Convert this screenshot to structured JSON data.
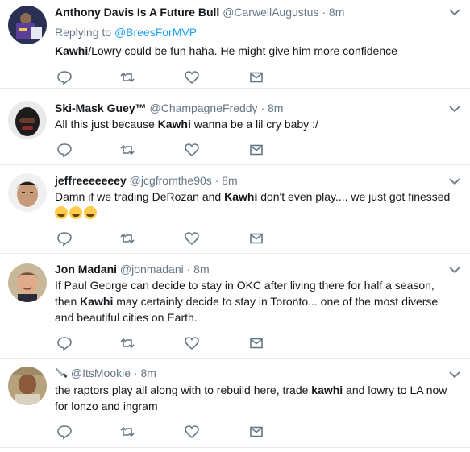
{
  "tweets": [
    {
      "name": "Anthony Davis Is A Future Bull",
      "handle": "@CarwellAugustus",
      "time": "8m",
      "reply_prefix": "Replying to ",
      "reply_handle": "@BreesForMVP",
      "text_parts": [
        {
          "t": "Kawhi",
          "b": true
        },
        {
          "t": "/Lowry could be fun haha. He might give him more confidence",
          "b": false
        }
      ]
    },
    {
      "name": "Ski-Mask Guey™",
      "handle": "@ChampagneFreddy",
      "time": "8m",
      "text_parts": [
        {
          "t": "All this just because ",
          "b": false
        },
        {
          "t": "Kawhi",
          "b": true
        },
        {
          "t": " wanna be a lil cry baby :/",
          "b": false
        }
      ]
    },
    {
      "name": "jeffreeeeeeey",
      "handle": "@jcgfromthe90s",
      "time": "8m",
      "text_parts": [
        {
          "t": "Damn if we trading DeRozan and ",
          "b": false
        },
        {
          "t": "Kawhi",
          "b": true
        },
        {
          "t": " don't even play.... we just got finessed",
          "b": false
        }
      ],
      "emoji": [
        "face-with-tears-of-joy",
        "face-with-tears-of-joy",
        "face-with-tears-of-joy"
      ]
    },
    {
      "name": "Jon Madani",
      "handle": "@jonmadani",
      "time": "8m",
      "text_parts": [
        {
          "t": "If Paul George can decide to stay in OKC after living there for half a season, then ",
          "b": false
        },
        {
          "t": "Kawhi",
          "b": true
        },
        {
          "t": " may certainly decide to stay in Toronto... one of the most diverse and beautiful cities on Earth.",
          "b": false
        }
      ]
    },
    {
      "name": "",
      "name_icon": "knife-icon",
      "handle": "@ItsMookie",
      "time": "8m",
      "text_parts": [
        {
          "t": "the raptors play all along with to rebuild here, trade ",
          "b": false
        },
        {
          "t": "kawhi",
          "b": true
        },
        {
          "t": " and lowry to LA now for lonzo and ingram",
          "b": false
        }
      ]
    }
  ],
  "separator": "·",
  "icons": {
    "reply": "reply-icon",
    "retweet": "retweet-icon",
    "like": "heart-icon",
    "message": "envelope-icon",
    "menu": "chevron-down-icon"
  },
  "colors": {
    "name": "#14171a",
    "meta": "#657786",
    "link": "#1da1f2",
    "divider": "#e6ecf0"
  }
}
